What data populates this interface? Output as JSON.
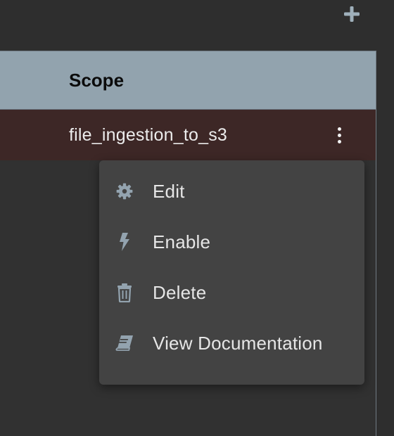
{
  "toolbar": {
    "add_icon": "plus-icon"
  },
  "table": {
    "header": {
      "scope": "Scope"
    },
    "rows": [
      {
        "scope": "file_ingestion_to_s3",
        "actions_icon": "kebab-menu-icon"
      }
    ]
  },
  "context_menu": {
    "items": [
      {
        "label": "Edit",
        "icon": "gear-icon"
      },
      {
        "label": "Enable",
        "icon": "lightning-bolt-icon"
      },
      {
        "label": "Delete",
        "icon": "trash-icon"
      },
      {
        "label": "View Documentation",
        "icon": "book-icon"
      }
    ]
  },
  "colors": {
    "background": "#2e2e2e",
    "header_bg": "#92a3ae",
    "selected_row_bg": "#3d2726",
    "menu_bg": "#434343",
    "icon_color": "#93a3af"
  }
}
